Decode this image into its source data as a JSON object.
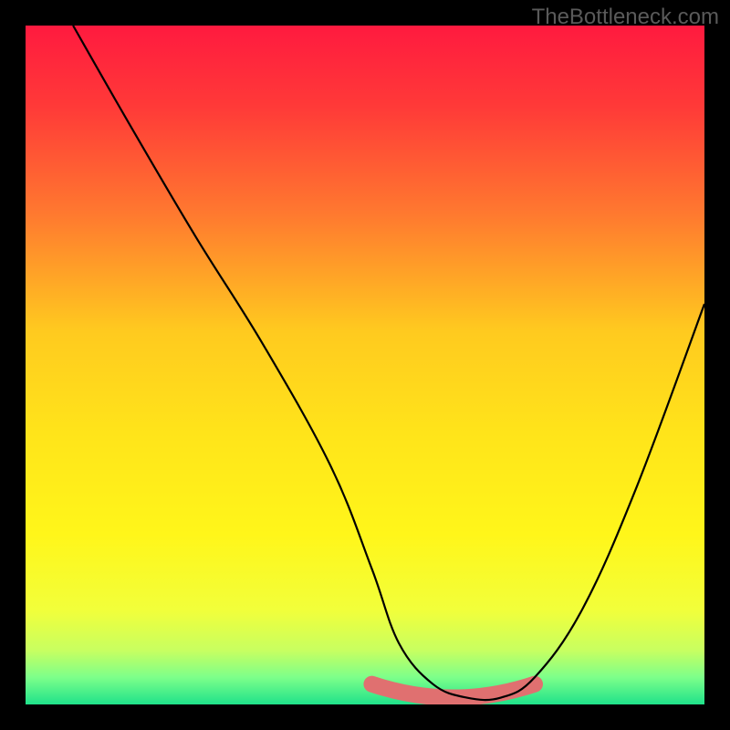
{
  "watermark": "TheBottleneck.com",
  "gradient": {
    "stops": [
      {
        "offset": 0.0,
        "color": "#ff1a3f"
      },
      {
        "offset": 0.12,
        "color": "#ff3a38"
      },
      {
        "offset": 0.28,
        "color": "#ff7a2f"
      },
      {
        "offset": 0.45,
        "color": "#ffca1f"
      },
      {
        "offset": 0.6,
        "color": "#ffe41a"
      },
      {
        "offset": 0.75,
        "color": "#fff61a"
      },
      {
        "offset": 0.86,
        "color": "#f2ff3a"
      },
      {
        "offset": 0.92,
        "color": "#c8ff60"
      },
      {
        "offset": 0.96,
        "color": "#7dff8a"
      },
      {
        "offset": 1.0,
        "color": "#1fe28a"
      }
    ]
  },
  "chart_data": {
    "type": "line",
    "title": "",
    "xlabel": "",
    "ylabel": "",
    "xlim": [
      0,
      100
    ],
    "ylim": [
      0,
      100
    ],
    "series": [
      {
        "name": "curve",
        "x": [
          7,
          15,
          25,
          35,
          45,
          51,
          55,
          60,
          65,
          70,
          75,
          82,
          90,
          100
        ],
        "y": [
          100,
          86,
          69,
          53,
          35,
          20,
          9,
          3,
          1,
          1,
          4,
          14,
          32,
          59
        ]
      }
    ],
    "floor_band": {
      "name": "floor-band",
      "color": "#e07070",
      "x_start": 51,
      "x_end": 75,
      "y": 3,
      "thickness_px": 18
    }
  }
}
